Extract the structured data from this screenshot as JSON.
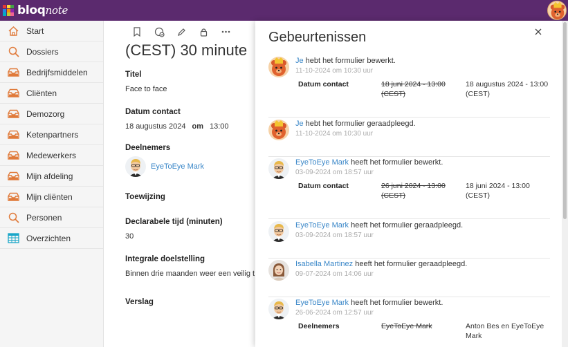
{
  "app": {
    "logo_text_bold": "bloq",
    "logo_text_script": "note",
    "logo_colors": [
      "#e53935",
      "#fdd835",
      "#43a047",
      "#1e88e5",
      "#fb8c00",
      "#8e24aa",
      "#00acc1",
      "#c0ca33",
      "#f06292"
    ]
  },
  "colors": {
    "topbar": "#5b2a6e",
    "link": "#3a87c8",
    "nav_icon": "#e07a3a",
    "overzichten_icon": "#1aa6c8"
  },
  "sidebar": {
    "items": [
      {
        "label": "Start",
        "icon": "home-icon"
      },
      {
        "label": "Dossiers",
        "icon": "search-icon"
      },
      {
        "label": "Bedrijfsmiddelen",
        "icon": "tray-icon"
      },
      {
        "label": "Cliënten",
        "icon": "tray-icon"
      },
      {
        "label": "Demozorg",
        "icon": "tray-icon"
      },
      {
        "label": "Ketenpartners",
        "icon": "tray-icon"
      },
      {
        "label": "Medewerkers",
        "icon": "tray-icon"
      },
      {
        "label": "Mijn afdeling",
        "icon": "tray-icon"
      },
      {
        "label": "Mijn cliënten",
        "icon": "tray-icon"
      },
      {
        "label": "Personen",
        "icon": "search-icon"
      },
      {
        "label": "Overzichten",
        "icon": "table-icon"
      }
    ]
  },
  "form": {
    "title_partial": "(CEST) 30 minute",
    "titel_label": "Titel",
    "titel_value": "Face to face",
    "datum_label": "Datum contact",
    "datum_date": "18 augustus 2024",
    "datum_om": "om",
    "datum_time": "13:00",
    "deelnemers_label": "Deelnemers",
    "deelnemer_name": "EyeToEye Mark",
    "toewijzing_label": "Toewijzing",
    "declarabele_label": "Declarabele tijd (minuten)",
    "declarabele_value": "30",
    "integrale_label": "Integrale doelstelling",
    "integrale_value": "Binnen drie maanden weer een veilig t",
    "verslag_label": "Verslag"
  },
  "panel": {
    "title": "Gebeurtenissen",
    "events": [
      {
        "who": "Je",
        "action": " hebt het formulier bewerkt.",
        "time": "11-10-2024 om 10:30 uur",
        "avatar": "bear",
        "field": "Datum contact",
        "old": "18 juni 2024 - 13:00 (CEST)",
        "new": "18 augustus 2024 - 13:00 (CEST)"
      },
      {
        "who": "Je",
        "action": " hebt het formulier geraadpleegd.",
        "time": "11-10-2024 om 10:30 uur",
        "avatar": "bear"
      },
      {
        "who": "EyeToEye Mark",
        "action": " heeft het formulier bewerkt.",
        "time": "03-09-2024 om 18:57 uur",
        "avatar": "man",
        "field": "Datum contact",
        "old": "26 juni 2024 - 13:00 (CEST)",
        "new": "18 juni 2024 - 13:00 (CEST)"
      },
      {
        "who": "EyeToEye Mark",
        "action": " heeft het formulier geraadpleegd.",
        "time": "03-09-2024 om 18:57 uur",
        "avatar": "man"
      },
      {
        "who": "Isabella Martinez",
        "action": " heeft het formulier geraadpleegd.",
        "time": "09-07-2024 om 14:06 uur",
        "avatar": "woman"
      },
      {
        "who": "EyeToEye Mark",
        "action": " heeft het formulier bewerkt.",
        "time": "26-06-2024 om 12:57 uur",
        "avatar": "man",
        "field": "Deelnemers",
        "old": "EyeToEye Mark",
        "new": "Anton Bes en EyeToEye Mark"
      }
    ]
  }
}
